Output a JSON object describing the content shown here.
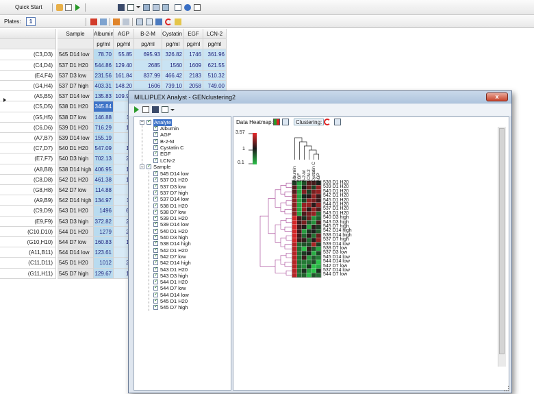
{
  "toolbar": {
    "quick_start": "Quick Start",
    "plates_label": "Plates:",
    "plate_number": "1"
  },
  "grid": {
    "headers": [
      "Sample",
      "Albumin",
      "AGP",
      "B-2-M",
      "Cystatin C",
      "EGF",
      "LCN-2"
    ],
    "units": [
      "pg/ml",
      "pg/ml",
      "pg/ml",
      "pg/ml",
      "pg/ml",
      "pg/ml"
    ],
    "rows": [
      {
        "label": "(C3,D3)",
        "sample": "545 D14 low",
        "values": [
          "78.70",
          "55.85",
          "695.93",
          "326.82",
          "1746",
          "361.96"
        ]
      },
      {
        "label": "(C4,D4)",
        "sample": "537 D1 H20",
        "values": [
          "544.86",
          "129.40",
          "2685",
          "1560",
          "1609",
          "621.55"
        ]
      },
      {
        "label": "(E4,F4)",
        "sample": "537 D3 low",
        "values": [
          "231.56",
          "161.84",
          "837.99",
          "466.42",
          "2183",
          "510.32"
        ]
      },
      {
        "label": "(G4,H4)",
        "sample": "537 D7 high",
        "values": [
          "403.31",
          "148.20",
          "1606",
          "739.10",
          "2058",
          "749.00"
        ]
      },
      {
        "label": "(A5,B5)",
        "sample": "537 D14 low",
        "values": [
          "135.83",
          "109.90",
          "417.11",
          "274.05",
          "1549",
          "451.14"
        ]
      },
      {
        "label": "(C5,D5)",
        "sample": "538 D1 H20",
        "values": [
          "345.84",
          "7",
          "",
          "",
          "",
          ""
        ]
      },
      {
        "label": "(G5,H5)",
        "sample": "538 D7 low",
        "values": [
          "146.88",
          "11",
          "",
          "",
          "",
          ""
        ]
      },
      {
        "label": "(C6,D6)",
        "sample": "539 D1 H20",
        "values": [
          "716.29",
          "14",
          "",
          "",
          "",
          ""
        ]
      },
      {
        "label": "(A7,B7)",
        "sample": "539 D14 low",
        "values": [
          "155.19",
          "9",
          "",
          "",
          "",
          ""
        ]
      },
      {
        "label": "(C7,D7)",
        "sample": "540 D1 H20",
        "values": [
          "547.09",
          "14",
          "",
          "",
          "",
          ""
        ]
      },
      {
        "label": "(E7,F7)",
        "sample": "540 D3 high",
        "values": [
          "702.13",
          "24",
          "",
          "",
          "",
          ""
        ]
      },
      {
        "label": "(A8,B8)",
        "sample": "538 D14 high",
        "values": [
          "406.95",
          "18",
          "",
          "",
          "",
          ""
        ]
      },
      {
        "label": "(C8,D8)",
        "sample": "542 D1 H20",
        "values": [
          "461.38",
          "13",
          "",
          "",
          "",
          ""
        ]
      },
      {
        "label": "(G8,H8)",
        "sample": "542 D7 low",
        "values": [
          "114.88",
          "9",
          "",
          "",
          "",
          ""
        ]
      },
      {
        "label": "(A9,B9)",
        "sample": "542 D14 high",
        "values": [
          "134.97",
          "11",
          "",
          "",
          "",
          ""
        ]
      },
      {
        "label": "(C9,D9)",
        "sample": "543 D1 H20",
        "values": [
          "1496",
          "63",
          "",
          "",
          "",
          ""
        ]
      },
      {
        "label": "(E9,F9)",
        "sample": "543 D3 high",
        "values": [
          "372.82",
          "21",
          "",
          "",
          "",
          ""
        ]
      },
      {
        "label": "(C10,D10)",
        "sample": "544 D1 H20",
        "values": [
          "1279",
          "27",
          "",
          "",
          "",
          ""
        ]
      },
      {
        "label": "(G10,H10)",
        "sample": "544 D7 low",
        "values": [
          "160.83",
          "13",
          "",
          "",
          "",
          ""
        ]
      },
      {
        "label": "(A11,B11)",
        "sample": "544 D14 low",
        "values": [
          "123.61",
          "8",
          "",
          "",
          "",
          ""
        ]
      },
      {
        "label": "(C11,D11)",
        "sample": "545 D1 H20",
        "values": [
          "1012",
          "21",
          "",
          "",
          "",
          ""
        ]
      },
      {
        "label": "(G11,H11)",
        "sample": "545 D7 high",
        "values": [
          "129.67",
          "10",
          "",
          "",
          "",
          ""
        ]
      }
    ]
  },
  "window": {
    "title": "MILLIPLEX Analyst - GENclustering2",
    "close_glyph": "x",
    "data_heatmap_label": "Data Heatmap:",
    "clustering_label": "Clustering:"
  },
  "tree": {
    "analyte_label": "Analyte",
    "analytes": [
      "Albumin",
      "AGP",
      "B-2-M",
      "Cystatin C",
      "EGF",
      "LCN-2"
    ],
    "sample_label": "Sample",
    "samples": [
      "545 D14 low",
      "537 D1 H20",
      "537 D3 low",
      "537 D7 high",
      "537 D14 low",
      "538 D1 H20",
      "538 D7 low",
      "539 D1 H20",
      "539 D14 low",
      "540 D1 H20",
      "540 D3 high",
      "538 D14 high",
      "542 D1 H20",
      "542 D7 low",
      "542 D14 high",
      "543 D1 H20",
      "543 D3 high",
      "544 D1 H20",
      "544 D7 low",
      "544 D14 low",
      "545 D1 H20",
      "545 D7 high"
    ]
  },
  "heatmap": {
    "scale_max": "3.57",
    "scale_mid": "1",
    "scale_min": "0.1",
    "column_labels": [
      "Albumin",
      "EGF",
      "B-2-M",
      "LCN-2",
      "Cystatin C",
      "AGP"
    ],
    "row_labels": [
      "538 D1 H20",
      "539 D1 H20",
      "540 D1 H20",
      "542 D1 H20",
      "545 D1 H20",
      "544 D1 H20",
      "537 D1 H20",
      "543 D1 H20",
      "540 D3 high",
      "543 D3 high",
      "545 D7 high",
      "542 D14 high",
      "538 D14 high",
      "537 D7 high",
      "539 D14 low",
      "538 D7 low",
      "537 D3 low",
      "545 D14 low",
      "544 D14 low",
      "542 D7 low",
      "537 D14 low",
      "544 D7 low"
    ],
    "colors": {
      "high": "#e8282a",
      "mid": "#1a1a1a",
      "low": "#2cc24a"
    }
  }
}
